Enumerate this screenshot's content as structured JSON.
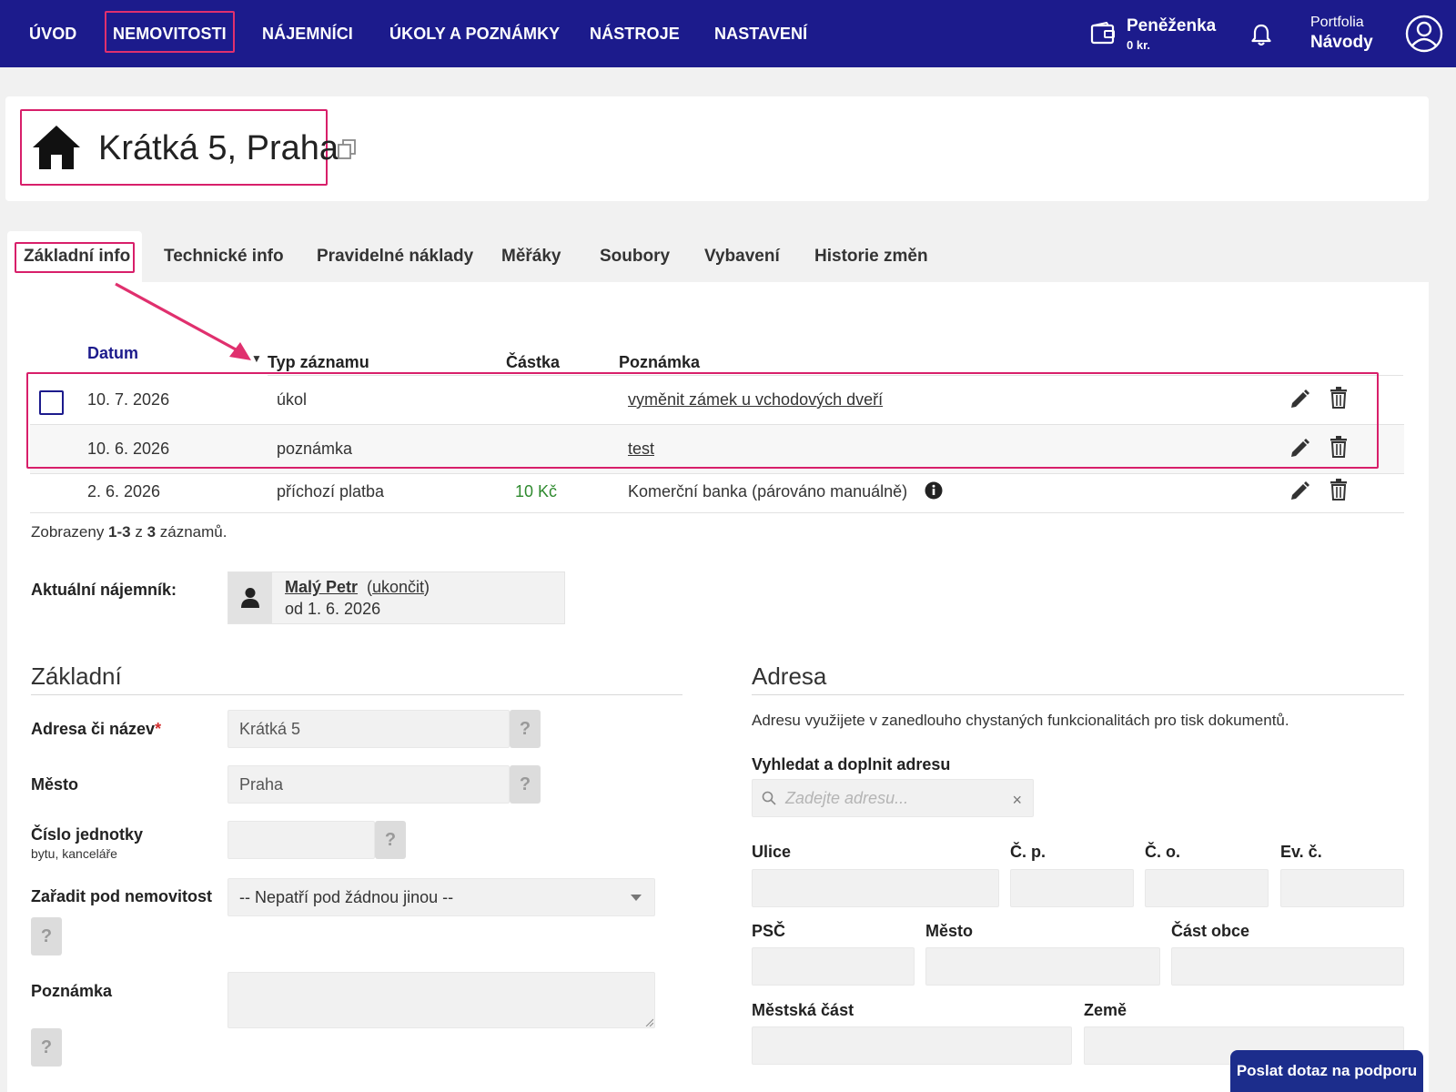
{
  "nav": {
    "items": [
      {
        "label": "ÚVOD"
      },
      {
        "label": "NEMOVITOSTI"
      },
      {
        "label": "NÁJEMNÍCI"
      },
      {
        "label": "ÚKOLY A POZNÁMKY"
      },
      {
        "label": "NÁSTROJE"
      },
      {
        "label": "NASTAVENÍ"
      }
    ],
    "active_index": 1,
    "wallet": {
      "title": "Peněženka",
      "amount": "0 kr.",
      "icon": "wallet-icon"
    },
    "bell_icon": "bell-icon",
    "portfolio": {
      "label": "Portfolia",
      "name": "Návody"
    },
    "avatar_icon": "user-circle-icon",
    "bg_color": "#1c1b8c",
    "highlight_color": "#d81f6a"
  },
  "property": {
    "title": "Krátká 5, Praha",
    "icon": "home-icon",
    "copy_icon": "copy-icon"
  },
  "tabs": [
    {
      "label": "Základní info"
    },
    {
      "label": "Technické info"
    },
    {
      "label": "Pravidelné náklady"
    },
    {
      "label": "Měřáky"
    },
    {
      "label": "Soubory"
    },
    {
      "label": "Vybavení"
    },
    {
      "label": "Historie změn"
    }
  ],
  "active_tab": 0,
  "table": {
    "columns": {
      "date": "Datum",
      "type": "Typ záznamu",
      "amount": "Částka",
      "note": "Poznámka"
    },
    "sort_column": "date",
    "sort_indicator": "▼",
    "rows": [
      {
        "date": "10. 7. 2026",
        "type": "úkol",
        "amount": "",
        "note": "vyměnit zámek u vchodových dveří",
        "note_link": true,
        "checkbox": true
      },
      {
        "date": "10. 6. 2026",
        "type": "poznámka",
        "amount": "",
        "note": "test",
        "note_link": true,
        "checkbox": false
      },
      {
        "date": "2. 6. 2026",
        "type": "příchozí platba",
        "amount": "10 Kč",
        "note": "Komerční banka (párováno manuálně)",
        "note_link": false,
        "checkbox": false,
        "info": true
      }
    ],
    "pager": {
      "prefix": "Zobrazeny ",
      "range": "1-3",
      "mid": " z ",
      "total": "3",
      "suffix": " záznamů."
    }
  },
  "tenant": {
    "label": "Aktuální nájemník:",
    "name": "Malý Petr",
    "end_prefix": "(",
    "end_link": "ukončit",
    "end_suffix": ")",
    "since": "od 1. 6. 2026",
    "icon": "person-icon"
  },
  "basic": {
    "title": "Základní",
    "fields": {
      "address": {
        "label": "Adresa či název",
        "required_mark": "*",
        "value": "Krátká 5"
      },
      "city": {
        "label": "Město",
        "value": "Praha"
      },
      "unit": {
        "label": "Číslo jednotky",
        "sublabel": "bytu, kanceláře",
        "value": ""
      },
      "parent": {
        "label": "Zařadit pod nemovitost",
        "value": "-- Nepatří pod žádnou jinou --"
      },
      "note": {
        "label": "Poznámka",
        "value": ""
      }
    },
    "help_label": "?"
  },
  "address": {
    "title": "Adresa",
    "description": "Adresu využijete v zanedlouho chystaných funkcionalitách pro tisk dokumentů.",
    "search_label": "Vyhledat a doplnit adresu",
    "search_placeholder": "Zadejte adresu...",
    "clear_label": "×",
    "fields": {
      "street": "Ulice",
      "cp": "Č. p.",
      "co": "Č. o.",
      "ev": "Ev. č.",
      "psc": "PSČ",
      "city": "Město",
      "part": "Část obce",
      "district": "Městská část",
      "country": "Země"
    }
  },
  "support_button": "Poslat dotaz na podporu"
}
